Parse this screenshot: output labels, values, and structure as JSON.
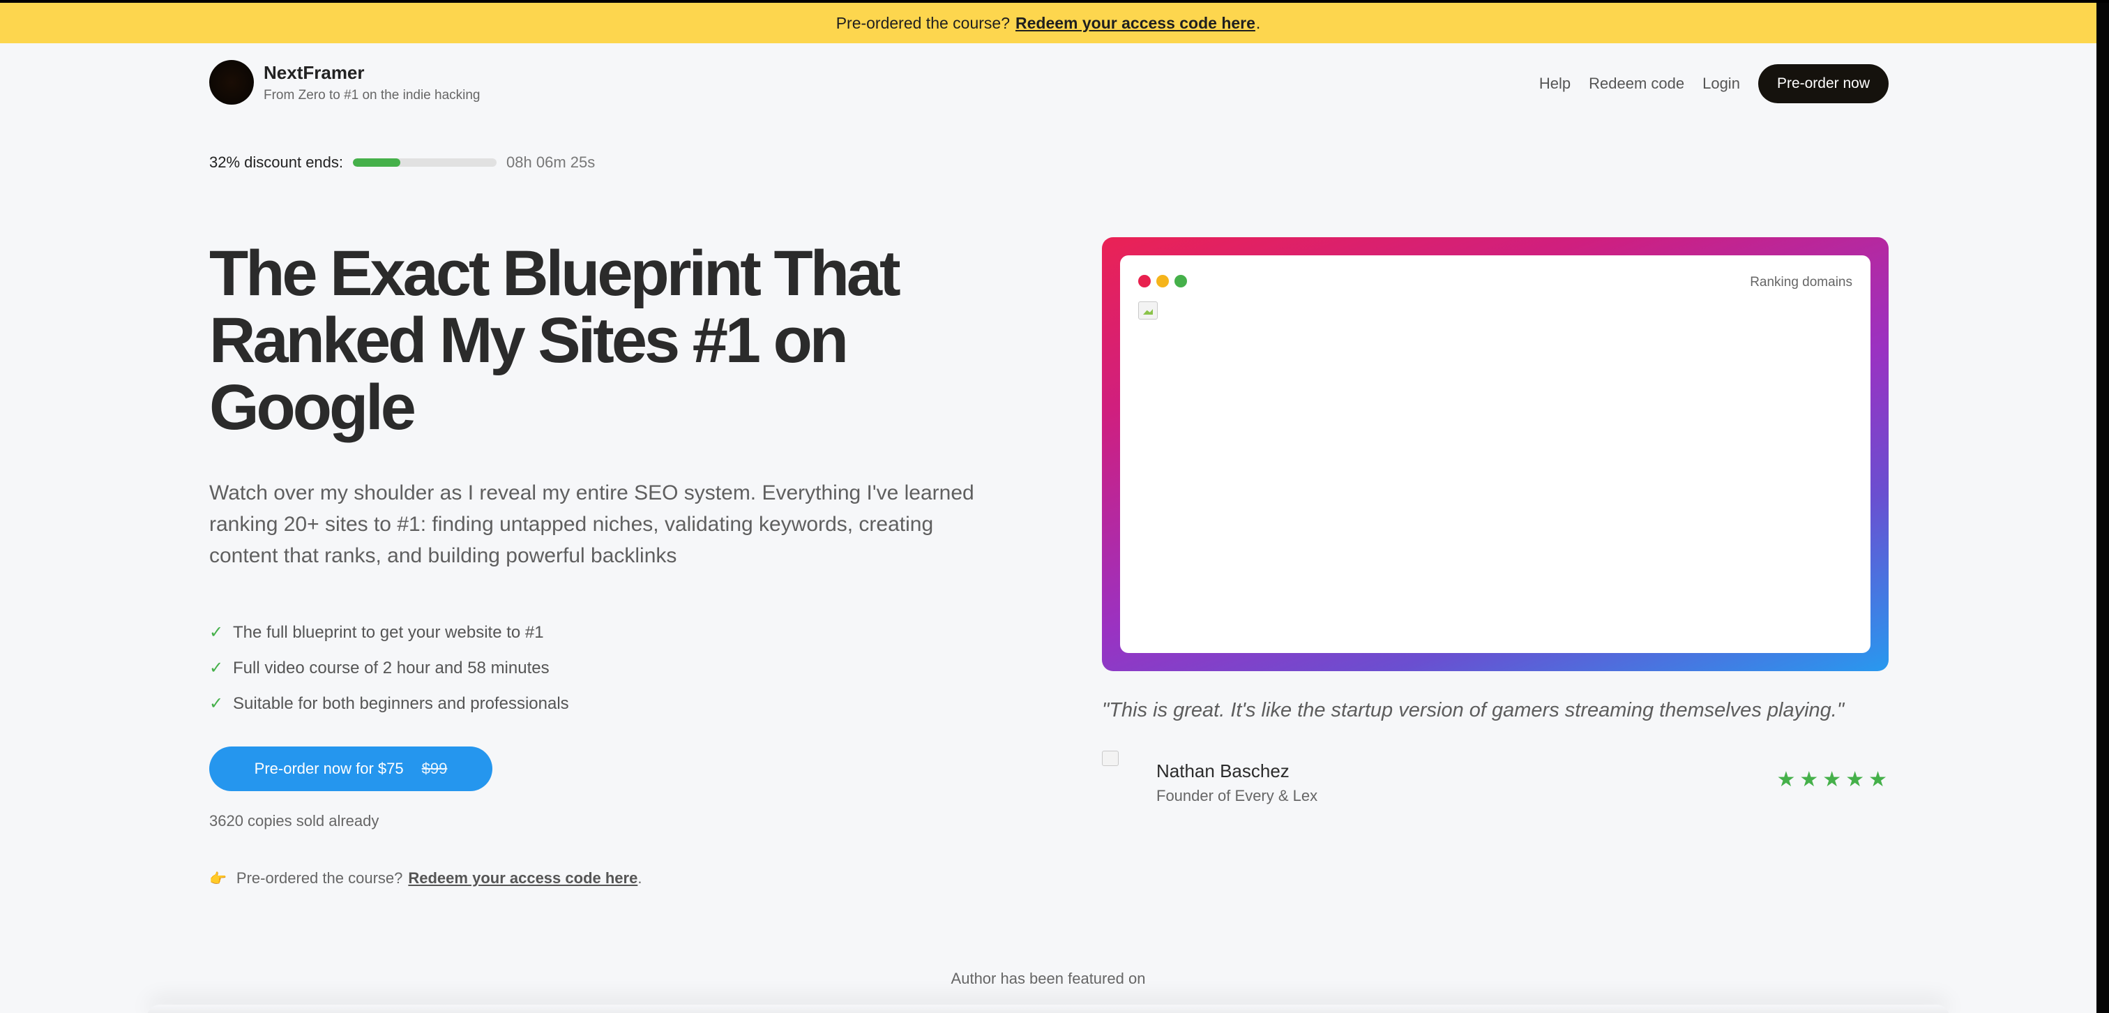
{
  "banner": {
    "text": "Pre-ordered the course?",
    "link": "Redeem your access code here",
    "suffix": "."
  },
  "brand": {
    "name": "NextFramer",
    "tagline": "From Zero to #1 on the indie hacking"
  },
  "nav": {
    "help": "Help",
    "redeem": "Redeem code",
    "login": "Login",
    "cta": "Pre-order now"
  },
  "discount": {
    "label": "32% discount ends:",
    "progress_percent": 33,
    "countdown": "08h 06m 25s"
  },
  "hero": {
    "headline": "The Exact Blueprint That Ranked My Sites #1 on Google",
    "subtext": "Watch over my shoulder as I reveal my entire SEO system. Everything I've learned ranking 20+ sites to #1: finding untapped niches, validating keywords, creating content that ranks, and building powerful backlinks",
    "features": [
      "The full blueprint to get your website to #1",
      "Full video course of 2 hour and 58 minutes",
      "Suitable for both beginners and professionals"
    ],
    "buy_label": "Pre-order now for $75",
    "old_price": "$99",
    "sold": "3620 copies sold already",
    "redeem_text": "Pre-ordered the course?",
    "redeem_link": "Redeem your access code here",
    "redeem_suffix": "."
  },
  "preview": {
    "label": "Ranking domains"
  },
  "testimonial": {
    "quote": "\"This is great. It's like the startup version of gamers streaming themselves playing.\"",
    "name": "Nathan Baschez",
    "role": "Founder of Every & Lex",
    "avatar_alt": "Nathan Baschez",
    "rating": 5
  },
  "featured": {
    "label": "Author has been featured on"
  },
  "colors": {
    "banner": "#fdd64e",
    "accent": "#2596ee",
    "success": "#45b04a",
    "dark": "#15120d"
  }
}
